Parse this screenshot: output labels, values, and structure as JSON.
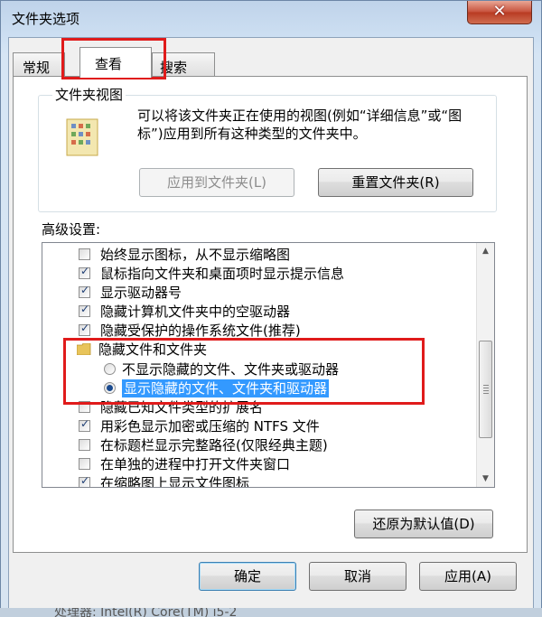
{
  "window": {
    "title": "文件夹选项",
    "close_glyph": "✕"
  },
  "tabs": [
    {
      "label": "常规",
      "active": false
    },
    {
      "label": "查看",
      "active": true
    },
    {
      "label": "搜索",
      "active": false
    }
  ],
  "folder_view": {
    "group_label": "文件夹视图",
    "description": "可以将该文件夹正在使用的视图(例如“详细信息”或“图标”)应用到所有这种类型的文件夹中。",
    "apply_button": "应用到文件夹(L)",
    "reset_button": "重置文件夹(R)"
  },
  "advanced": {
    "label": "高级设置:",
    "items": [
      {
        "type": "checkbox",
        "checked": false,
        "label": "始终显示图标，从不显示缩略图"
      },
      {
        "type": "checkbox",
        "checked": true,
        "label": "鼠标指向文件夹和桌面项时显示提示信息"
      },
      {
        "type": "checkbox",
        "checked": true,
        "label": "显示驱动器号"
      },
      {
        "type": "checkbox",
        "checked": true,
        "label": "隐藏计算机文件夹中的空驱动器"
      },
      {
        "type": "checkbox",
        "checked": true,
        "label": "隐藏受保护的操作系统文件(推荐)"
      },
      {
        "type": "folder",
        "label": "隐藏文件和文件夹"
      },
      {
        "type": "radio",
        "checked": false,
        "label": "不显示隐藏的文件、文件夹或驱动器"
      },
      {
        "type": "radio",
        "checked": true,
        "selected": true,
        "label": "显示隐藏的文件、文件夹和驱动器"
      },
      {
        "type": "checkbox",
        "checked": false,
        "label": "隐藏已知文件类型的扩展名"
      },
      {
        "type": "checkbox",
        "checked": true,
        "label": "用彩色显示加密或压缩的 NTFS 文件"
      },
      {
        "type": "checkbox",
        "checked": false,
        "label": "在标题栏显示完整路径(仅限经典主题)"
      },
      {
        "type": "checkbox",
        "checked": false,
        "label": "在单独的进程中打开文件夹窗口"
      },
      {
        "type": "checkbox",
        "checked": true,
        "label": "在缩略图上显示文件图标"
      }
    ],
    "restore_button": "还原为默认值(D)"
  },
  "footer": {
    "ok": "确定",
    "cancel": "取消",
    "apply": "应用(A)"
  },
  "background_text": "处理器: Intel(R) Core(TM) i5-2",
  "colors": {
    "highlight_box": "#e01b1b",
    "selection": "#3399ff"
  }
}
